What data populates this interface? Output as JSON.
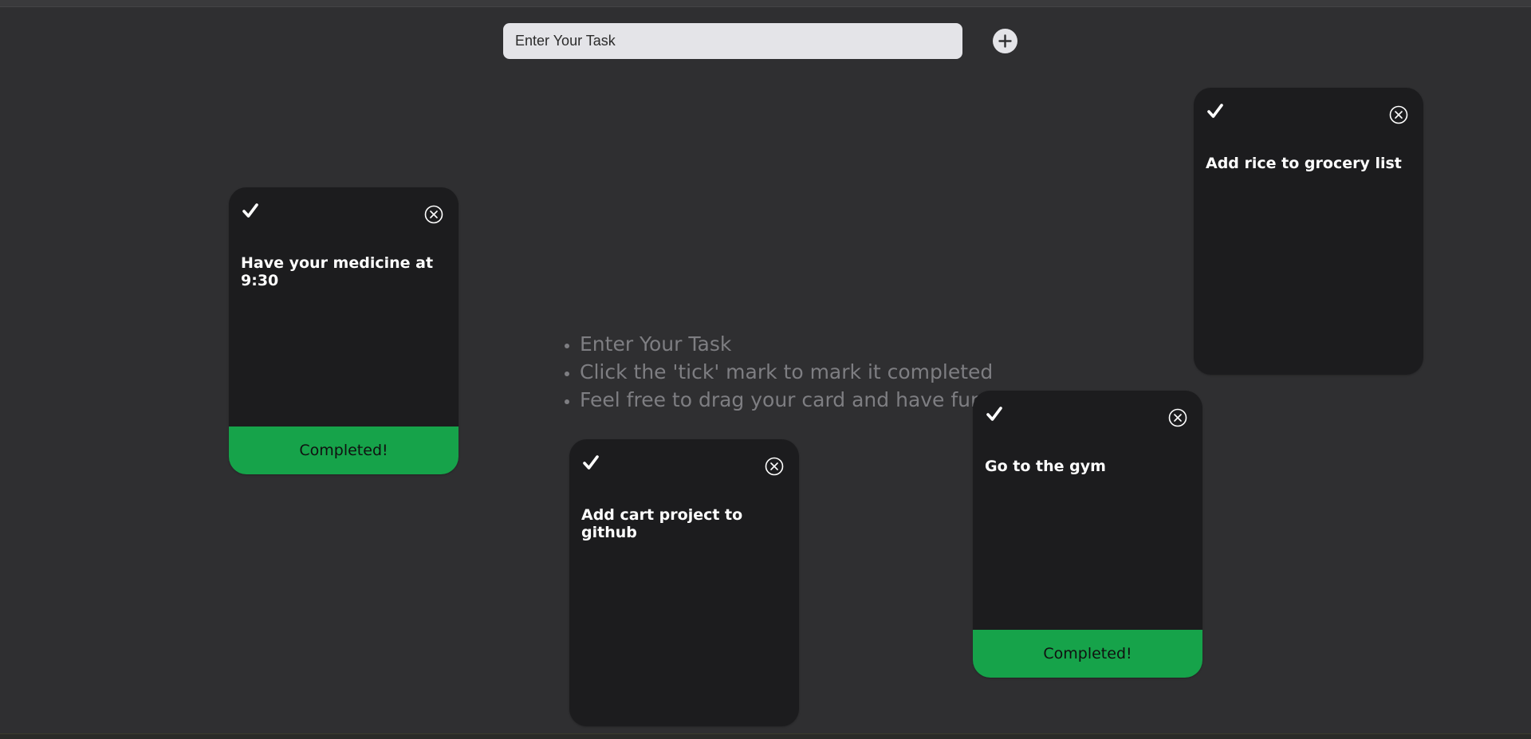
{
  "header": {
    "input_placeholder": "Enter Your Task",
    "add_icon": "plus-circle-icon"
  },
  "instructions": {
    "items": [
      "Enter Your Task",
      "Click the 'tick' mark to mark it completed",
      "Feel free to drag your card and have fun"
    ]
  },
  "cards": [
    {
      "text": "Have your medicine at 9:30",
      "completed": true,
      "status_label": "Completed!"
    },
    {
      "text": "Add cart project to github",
      "completed": false,
      "status_label": ""
    },
    {
      "text": "Go to the gym",
      "completed": true,
      "status_label": "Completed!"
    },
    {
      "text": "Add rice to grocery list",
      "completed": false,
      "status_label": ""
    }
  ],
  "colors": {
    "background": "#2f2f31",
    "card": "#1c1c1e",
    "completed": "#16a34a",
    "input": "#e4e4e8",
    "instructions_text": "#7e7e82"
  },
  "icons": {
    "check": "check-icon",
    "close": "close-circle-icon"
  }
}
